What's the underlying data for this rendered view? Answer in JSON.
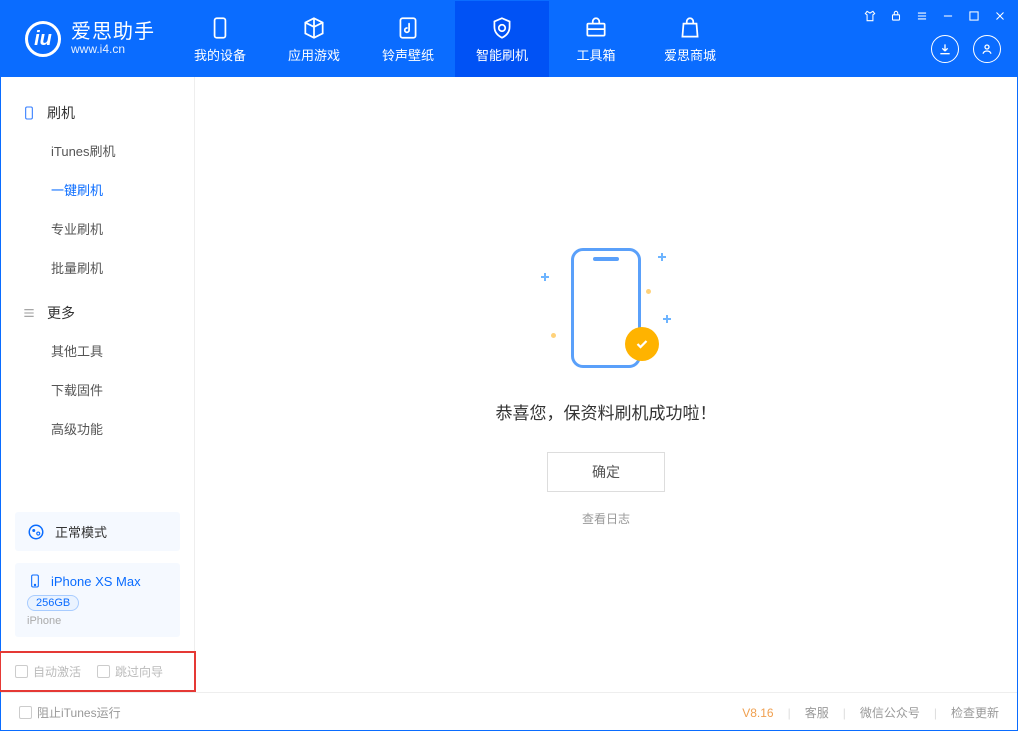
{
  "header": {
    "logo_cn": "爱思助手",
    "logo_en": "www.i4.cn",
    "tabs": [
      {
        "label": "我的设备"
      },
      {
        "label": "应用游戏"
      },
      {
        "label": "铃声壁纸"
      },
      {
        "label": "智能刷机"
      },
      {
        "label": "工具箱"
      },
      {
        "label": "爱思商城"
      }
    ]
  },
  "sidebar": {
    "group1_title": "刷机",
    "group1_items": [
      "iTunes刷机",
      "一键刷机",
      "专业刷机",
      "批量刷机"
    ],
    "group2_title": "更多",
    "group2_items": [
      "其他工具",
      "下载固件",
      "高级功能"
    ],
    "mode_label": "正常模式",
    "device": {
      "name": "iPhone XS Max",
      "capacity": "256GB",
      "type": "iPhone"
    },
    "chk_auto_activate": "自动激活",
    "chk_skip_guide": "跳过向导"
  },
  "main": {
    "success_msg": "恭喜您，保资料刷机成功啦！",
    "ok_btn": "确定",
    "view_log": "查看日志"
  },
  "footer": {
    "block_itunes": "阻止iTunes运行",
    "version": "V8.16",
    "service": "客服",
    "wechat": "微信公众号",
    "update": "检查更新"
  }
}
